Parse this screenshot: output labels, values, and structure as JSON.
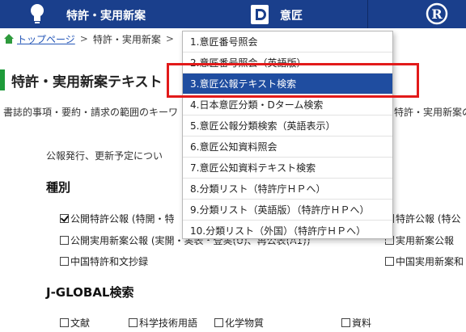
{
  "topnav": {
    "patent_label": "特許・実用新案",
    "design_label": "意匠",
    "trademark_symbol": "R"
  },
  "breadcrumb": {
    "home": "トップページ",
    "sep": ">",
    "current": "特許・実用新案",
    "sep2": ">"
  },
  "page": {
    "title": "特許・実用新案テキスト",
    "description": "書誌的事項・要約・請求の範囲のキーワ",
    "description_right": "特許・実用新案の公",
    "intro": "公報発行、更新予定につい"
  },
  "section_type": {
    "heading": "種別",
    "options": [
      {
        "label": "公開特許公報 (特開・特",
        "checked": true
      },
      {
        "label": "公開実用新案公報 (実開・実表・登実(U)、再公表(A1))",
        "checked": false
      },
      {
        "label": "中国特許和文抄録",
        "checked": false
      }
    ],
    "right_options": [
      {
        "label": "特許公報 (特公",
        "checked": false
      },
      {
        "label": "実用新案公報",
        "checked": false
      },
      {
        "label": "中国実用新案和",
        "checked": false
      }
    ]
  },
  "section_jglobal": {
    "heading": "J-GLOBAL検索",
    "options": [
      {
        "label": "文献",
        "checked": false
      },
      {
        "label": "科学技術用語",
        "checked": false
      },
      {
        "label": "化学物質",
        "checked": false
      },
      {
        "label": "資料",
        "checked": false
      }
    ]
  },
  "dropdown": {
    "items": [
      "1.意匠番号照会",
      "2.意匠番号照会（英語版）",
      "3.意匠公報テキスト検索",
      "4.日本意匠分類・Dターム検索",
      "5.意匠公報分類検索（英語表示）",
      "6.意匠公知資料照会",
      "7.意匠公知資料テキスト検索",
      "8.分類リスト（特許庁ＨＰへ）",
      "9.分類リスト（英語版）（特許庁ＨＰへ）",
      "10.分類リスト（外国）（特許庁ＨＰへ）"
    ],
    "active_index": 2
  },
  "colors": {
    "nav_bg": "#1a3f8c",
    "accent_green": "#1e9b3a",
    "menu_active": "#1f4da0",
    "highlight_red": "#e21a1a",
    "link": "#2557b8"
  }
}
